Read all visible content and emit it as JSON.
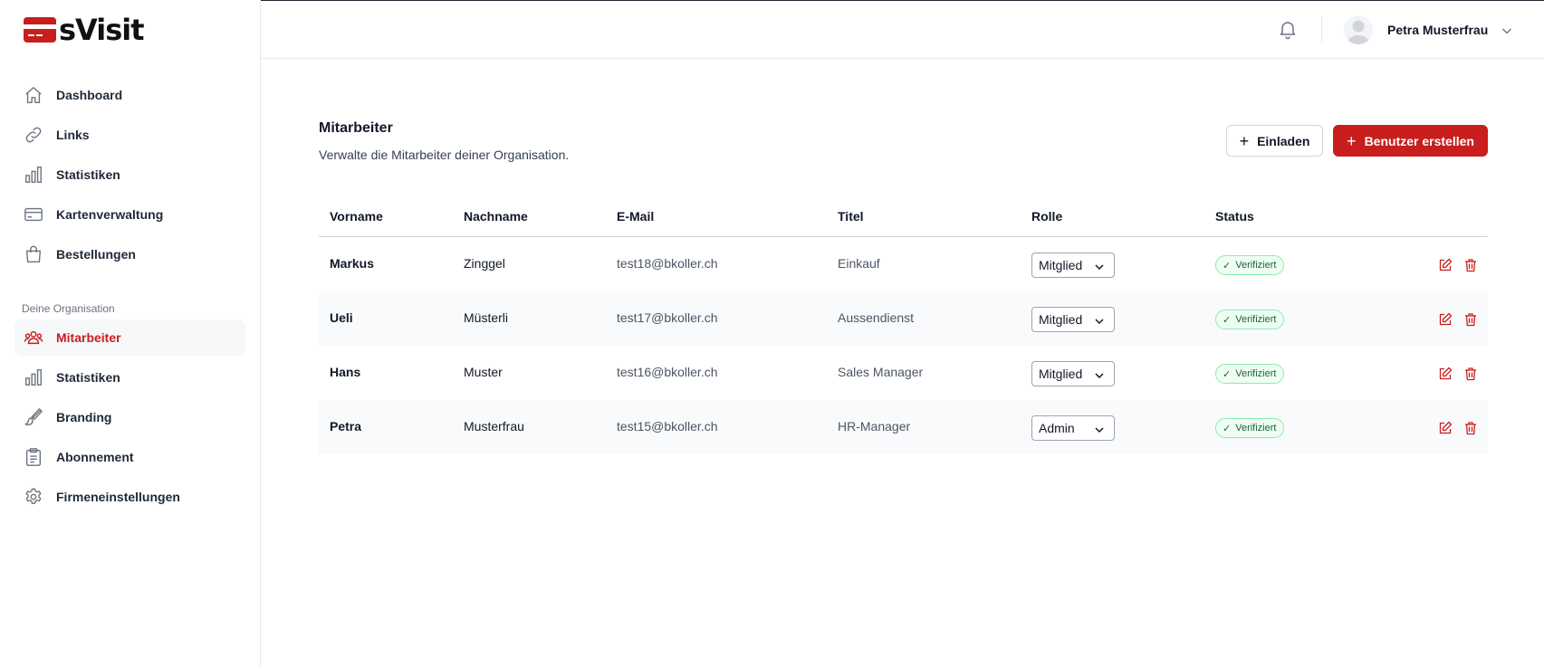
{
  "app": {
    "name": "sVisit"
  },
  "colors": {
    "accent": "#c81e1e",
    "badge_green": "#166534"
  },
  "sidebar": {
    "items": [
      {
        "label": "Dashboard",
        "icon": "home-icon"
      },
      {
        "label": "Links",
        "icon": "link-icon"
      },
      {
        "label": "Statistiken",
        "icon": "bar-chart-icon"
      },
      {
        "label": "Kartenverwaltung",
        "icon": "credit-card-icon"
      },
      {
        "label": "Bestellungen",
        "icon": "shopping-bag-icon"
      }
    ],
    "section_label": "Deine Organisation",
    "org_items": [
      {
        "label": "Mitarbeiter",
        "icon": "users-icon",
        "active": true
      },
      {
        "label": "Statistiken",
        "icon": "bar-chart-icon"
      },
      {
        "label": "Branding",
        "icon": "brush-icon"
      },
      {
        "label": "Abonnement",
        "icon": "clipboard-icon"
      },
      {
        "label": "Firmeneinstellungen",
        "icon": "gear-icon"
      }
    ]
  },
  "header": {
    "user_name": "Petra Musterfrau"
  },
  "main": {
    "title": "Mitarbeiter",
    "subtitle": "Verwalte die Mitarbeiter deiner Organisation.",
    "invite_label": "Einladen",
    "create_label": "Benutzer erstellen",
    "columns": [
      "Vorname",
      "Nachname",
      "E-Mail",
      "Titel",
      "Rolle",
      "Status"
    ],
    "rows": [
      {
        "first": "Markus",
        "last": "Zinggel",
        "email": "test18@bkoller.ch",
        "title": "Einkauf",
        "role": "Mitglied",
        "status": "Verifiziert"
      },
      {
        "first": "Ueli",
        "last": "Müsterli",
        "email": "test17@bkoller.ch",
        "title": "Aussendienst",
        "role": "Mitglied",
        "status": "Verifiziert"
      },
      {
        "first": "Hans",
        "last": "Muster",
        "email": "test16@bkoller.ch",
        "title": "Sales Manager",
        "role": "Mitglied",
        "status": "Verifiziert"
      },
      {
        "first": "Petra",
        "last": "Musterfrau",
        "email": "test15@bkoller.ch",
        "title": "HR-Manager",
        "role": "Admin",
        "status": "Verifiziert"
      }
    ]
  }
}
